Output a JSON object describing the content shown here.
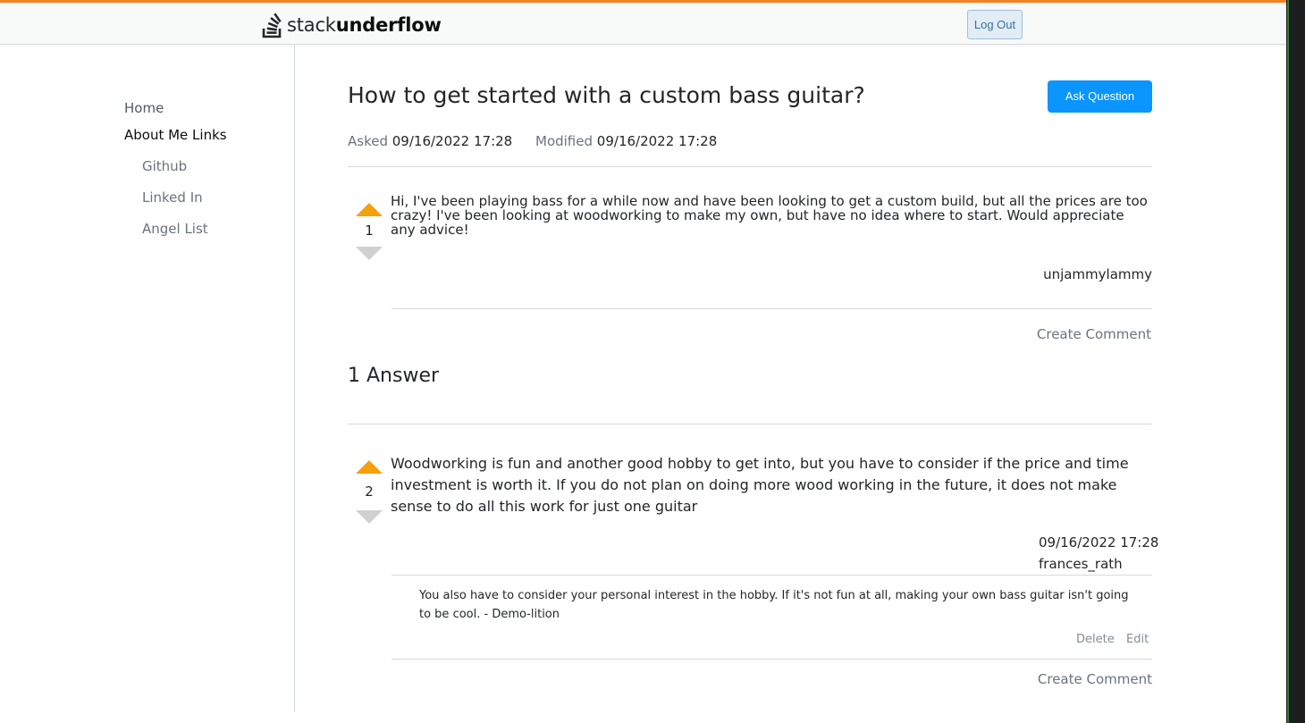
{
  "header": {
    "logo_left": "stack",
    "logo_right": "underflow",
    "logout_label": "Log Out"
  },
  "sidebar": {
    "home": "Home",
    "about": "About Me Links",
    "links": [
      "Github",
      "Linked In",
      "Angel List"
    ]
  },
  "question": {
    "title": "How to get started with a custom bass guitar?",
    "ask_label": "Ask Question",
    "asked_label": "Asked",
    "asked_value": "09/16/2022 17:28",
    "modified_label": "Modified",
    "modified_value": "09/16/2022 17:28",
    "score": "1",
    "body": "Hi, I've been playing bass for a while now and have been looking to get a custom build, but all the prices are too crazy! I've been looking at woodworking to make my own, but have no idea where to start. Would appreciate any advice!",
    "author": "unjammylammy",
    "create_comment": "Create Comment"
  },
  "answers": {
    "heading": "1 Answer",
    "items": [
      {
        "score": "2",
        "body": "Woodworking is fun and another good hobby to get into, but you have to consider if the price and time investment is worth it. If you do not plan on doing more wood working in the future, it does not make sense to do all this work for just one guitar",
        "date": "09/16/2022 17:28",
        "author": "frances_rath",
        "comments": [
          {
            "text": "You also have to consider your personal interest in the hobby. If it's not fun at all, making your own bass guitar isn't going to be cool. - Demo-lition",
            "delete_label": "Delete",
            "edit_label": "Edit"
          }
        ],
        "create_comment": "Create Comment"
      }
    ]
  },
  "colors": {
    "accent": "#f48024",
    "primary_button": "#0a95ff",
    "upvote": "#f4a10b",
    "downvote": "#d0d0d0"
  }
}
